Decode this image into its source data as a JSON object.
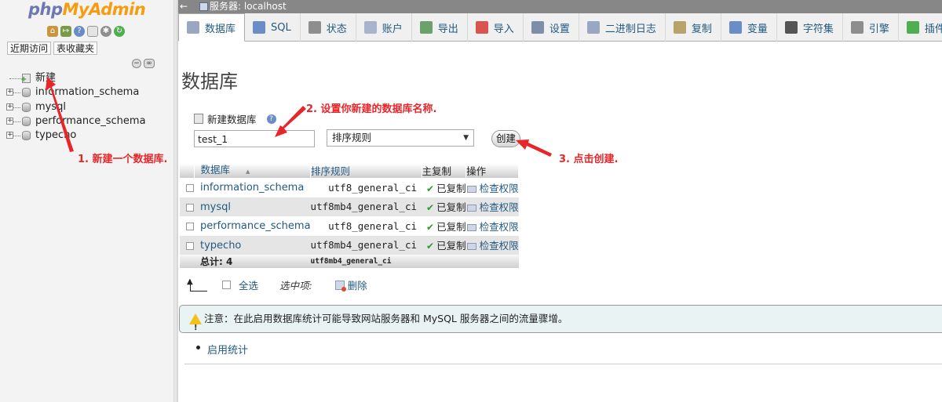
{
  "nav": {
    "logo_php": "php",
    "logo_myadmin": "MyAdmin",
    "icons": [
      "home-icon",
      "exit-icon",
      "help-icon",
      "docs-icon",
      "settings-icon",
      "reload-icon"
    ],
    "tabs": [
      "近期访问",
      "表收藏夹"
    ],
    "tree": [
      {
        "label": "新建",
        "type": "new"
      },
      {
        "label": "information_schema",
        "type": "db"
      },
      {
        "label": "mysql",
        "type": "db"
      },
      {
        "label": "performance_schema",
        "type": "db"
      },
      {
        "label": "typecho",
        "type": "db"
      }
    ]
  },
  "serverbar": {
    "back": "←",
    "text": "服务器: localhost"
  },
  "tabs": [
    {
      "label": "数据库",
      "icon": "database-icon",
      "color": "#9aa7c0",
      "active": true
    },
    {
      "label": "SQL",
      "icon": "sql-icon",
      "color": "#6b8dc7"
    },
    {
      "label": "状态",
      "icon": "status-icon",
      "color": "#8e8e8e"
    },
    {
      "label": "账户",
      "icon": "users-icon",
      "color": "#a7b4cc"
    },
    {
      "label": "导出",
      "icon": "export-icon",
      "color": "#6aa26a"
    },
    {
      "label": "导入",
      "icon": "import-icon",
      "color": "#d9534f"
    },
    {
      "label": "设置",
      "icon": "wrench-icon",
      "color": "#7f8ea8"
    },
    {
      "label": "二进制日志",
      "icon": "binlog-icon",
      "color": "#9aa7c0"
    },
    {
      "label": "复制",
      "icon": "replication-icon",
      "color": "#b8a36a"
    },
    {
      "label": "变量",
      "icon": "variables-icon",
      "color": "#6b8dc7"
    },
    {
      "label": "字符集",
      "icon": "charset-icon",
      "color": "#555555"
    },
    {
      "label": "引擎",
      "icon": "engine-icon",
      "color": "#8e8e8e"
    },
    {
      "label": "插件",
      "icon": "plugin-icon",
      "color": "#4fae4f"
    }
  ],
  "main": {
    "title": "数据库",
    "create_label": "新建数据库",
    "db_name_value": "test_1",
    "collation_placeholder": "排序规则",
    "create_button": "创建"
  },
  "table": {
    "headers": {
      "database": "数据库",
      "collation": "排序规则",
      "replication": "主复制",
      "action": "操作"
    },
    "sort_arrow": "▲",
    "rows": [
      {
        "name": "information_schema",
        "collation": "utf8_general_ci",
        "replication": "已复制",
        "action": "检查权限"
      },
      {
        "name": "mysql",
        "collation": "utf8mb4_general_ci",
        "replication": "已复制",
        "action": "检查权限"
      },
      {
        "name": "performance_schema",
        "collation": "utf8_general_ci",
        "replication": "已复制",
        "action": "检查权限"
      },
      {
        "name": "typecho",
        "collation": "utf8mb4_general_ci",
        "replication": "已复制",
        "action": "检查权限"
      }
    ],
    "total_label": "总计: 4",
    "total_collation": "utf8mb4_general_ci"
  },
  "bulk": {
    "check_all": "全选",
    "with_selected": "选中项:",
    "delete": "删除"
  },
  "notice": {
    "text": "注意：在此启用数据库统计可能导致网站服务器和 MySQL 服务器之间的流量骤增。"
  },
  "stats": {
    "link": "启用统计"
  },
  "annotations": {
    "step1": "1. 新建一个数据库.",
    "step2": "2. 设置你新建的数据库名称.",
    "step3": "3. 点击创建.",
    "color": "#e8262a"
  }
}
